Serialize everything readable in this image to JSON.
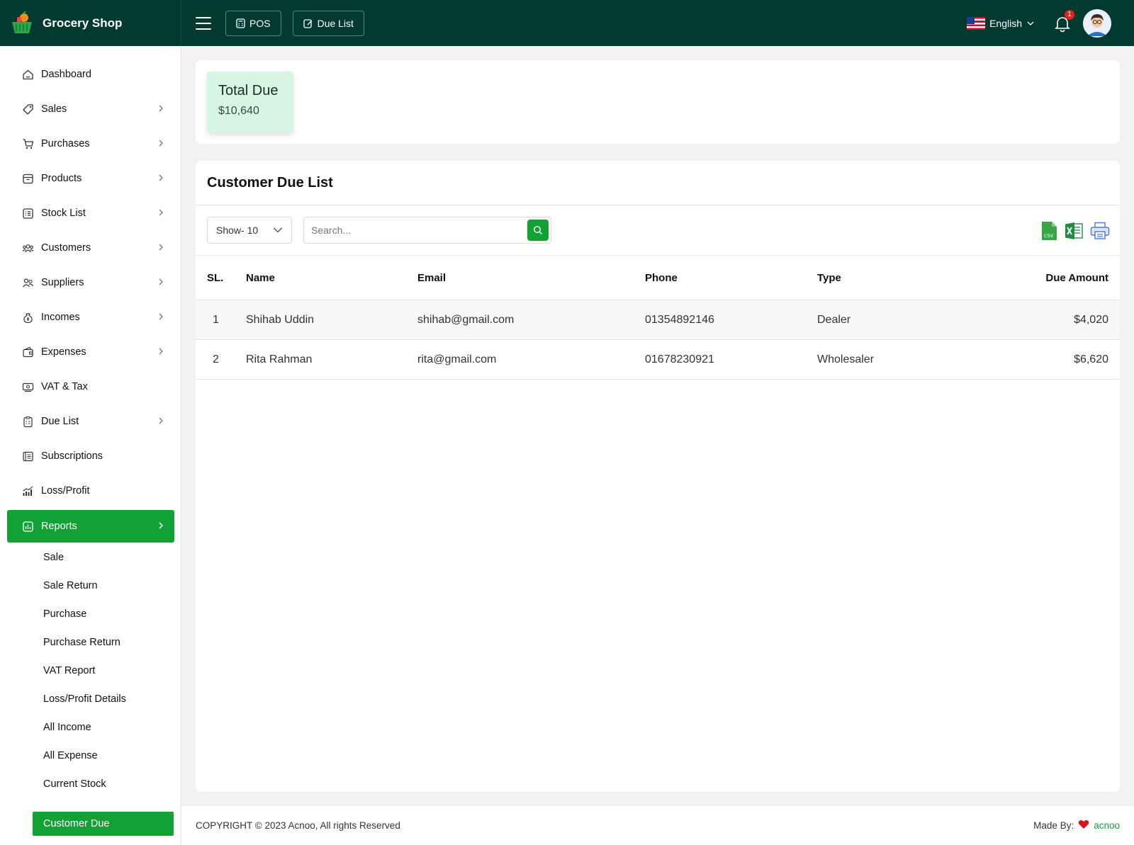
{
  "app": {
    "name": "Grocery Shop"
  },
  "header": {
    "pos_label": "POS",
    "due_list_label": "Due List",
    "language": "English",
    "notification_count": "1"
  },
  "sidebar": {
    "items": [
      {
        "label": "Dashboard",
        "icon": "home-icon",
        "has_children": false
      },
      {
        "label": "Sales",
        "icon": "tag-icon",
        "has_children": true
      },
      {
        "label": "Purchases",
        "icon": "cart-icon",
        "has_children": true
      },
      {
        "label": "Products",
        "icon": "box-icon",
        "has_children": true
      },
      {
        "label": "Stock List",
        "icon": "list-icon",
        "has_children": true
      },
      {
        "label": "Customers",
        "icon": "users-icon",
        "has_children": true
      },
      {
        "label": "Suppliers",
        "icon": "supplier-icon",
        "has_children": true
      },
      {
        "label": "Incomes",
        "icon": "money-bag-icon",
        "has_children": true
      },
      {
        "label": "Expenses",
        "icon": "wallet-icon",
        "has_children": true
      },
      {
        "label": "VAT & Tax",
        "icon": "banknote-icon",
        "has_children": false
      },
      {
        "label": "Due List",
        "icon": "clipboard-icon",
        "has_children": true
      },
      {
        "label": "Subscriptions",
        "icon": "subscription-icon",
        "has_children": false
      },
      {
        "label": "Loss/Profit",
        "icon": "chart-bars-icon",
        "has_children": false
      },
      {
        "label": "Reports",
        "icon": "report-icon",
        "has_children": true,
        "active": true
      }
    ],
    "report_subitems": [
      {
        "label": "Sale"
      },
      {
        "label": "Sale Return"
      },
      {
        "label": "Purchase"
      },
      {
        "label": "Purchase Return"
      },
      {
        "label": "VAT Report"
      },
      {
        "label": "Loss/Profit Details"
      },
      {
        "label": "All Income"
      },
      {
        "label": "All Expense"
      },
      {
        "label": "Current Stock"
      },
      {
        "label": "Customer Due",
        "active": true
      }
    ]
  },
  "summary": {
    "title": "Total Due",
    "value": "$10,640"
  },
  "due_list": {
    "title": "Customer Due List",
    "show_label": "Show- 10",
    "search_placeholder": "Search...",
    "columns": {
      "sl": "SL.",
      "name": "Name",
      "email": "Email",
      "phone": "Phone",
      "type": "Type",
      "amount": "Due Amount"
    },
    "rows": [
      {
        "sl": "1",
        "name": "Shihab Uddin",
        "email": "shihab@gmail.com",
        "phone": "01354892146",
        "type": "Dealer",
        "amount": "$4,020"
      },
      {
        "sl": "2",
        "name": "Rita Rahman",
        "email": "rita@gmail.com",
        "phone": "01678230921",
        "type": "Wholesaler",
        "amount": "$6,620"
      }
    ]
  },
  "footer": {
    "copyright": "COPYRIGHT © 2023 Acnoo, All rights Reserved",
    "made_by": "Made By:",
    "brand": "acnoo"
  },
  "colors": {
    "header_bg": "#023a2f",
    "accent": "#13a136",
    "due_card_bg": "#d7f5e3"
  }
}
